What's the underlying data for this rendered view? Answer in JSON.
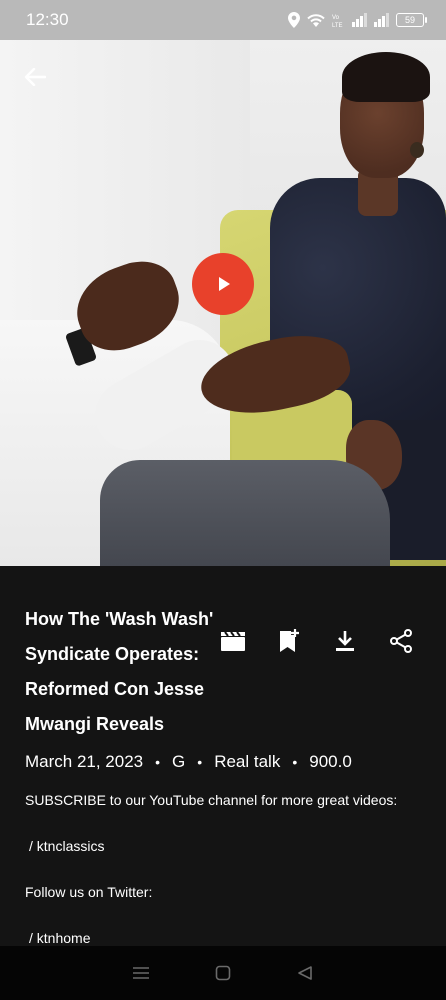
{
  "status_bar": {
    "time": "12:30",
    "battery": "59"
  },
  "video": {
    "back_icon": "arrow-left-icon",
    "play_icon": "play-icon",
    "play_color": "#e8412b"
  },
  "details": {
    "title": "How The 'Wash Wash' Syndicate Operates: Reformed Con Jesse Mwangi Reveals",
    "meta": {
      "date": "March 21, 2023",
      "rating": "G",
      "category": "Real talk",
      "value": "900.0",
      "separator": "•"
    },
    "actions": [
      {
        "icon": "clapperboard-icon"
      },
      {
        "icon": "bookmark-add-icon"
      },
      {
        "icon": "download-icon"
      },
      {
        "icon": "share-icon"
      }
    ],
    "description_lines": [
      "SUBSCRIBE to our YouTube channel for more great videos:",
      "/ ktnclassics",
      "Follow us on Twitter:",
      "/ ktnhome"
    ]
  },
  "nav_bar": {
    "icons": [
      "menu-icon",
      "home-square-icon",
      "back-triangle-icon"
    ]
  }
}
